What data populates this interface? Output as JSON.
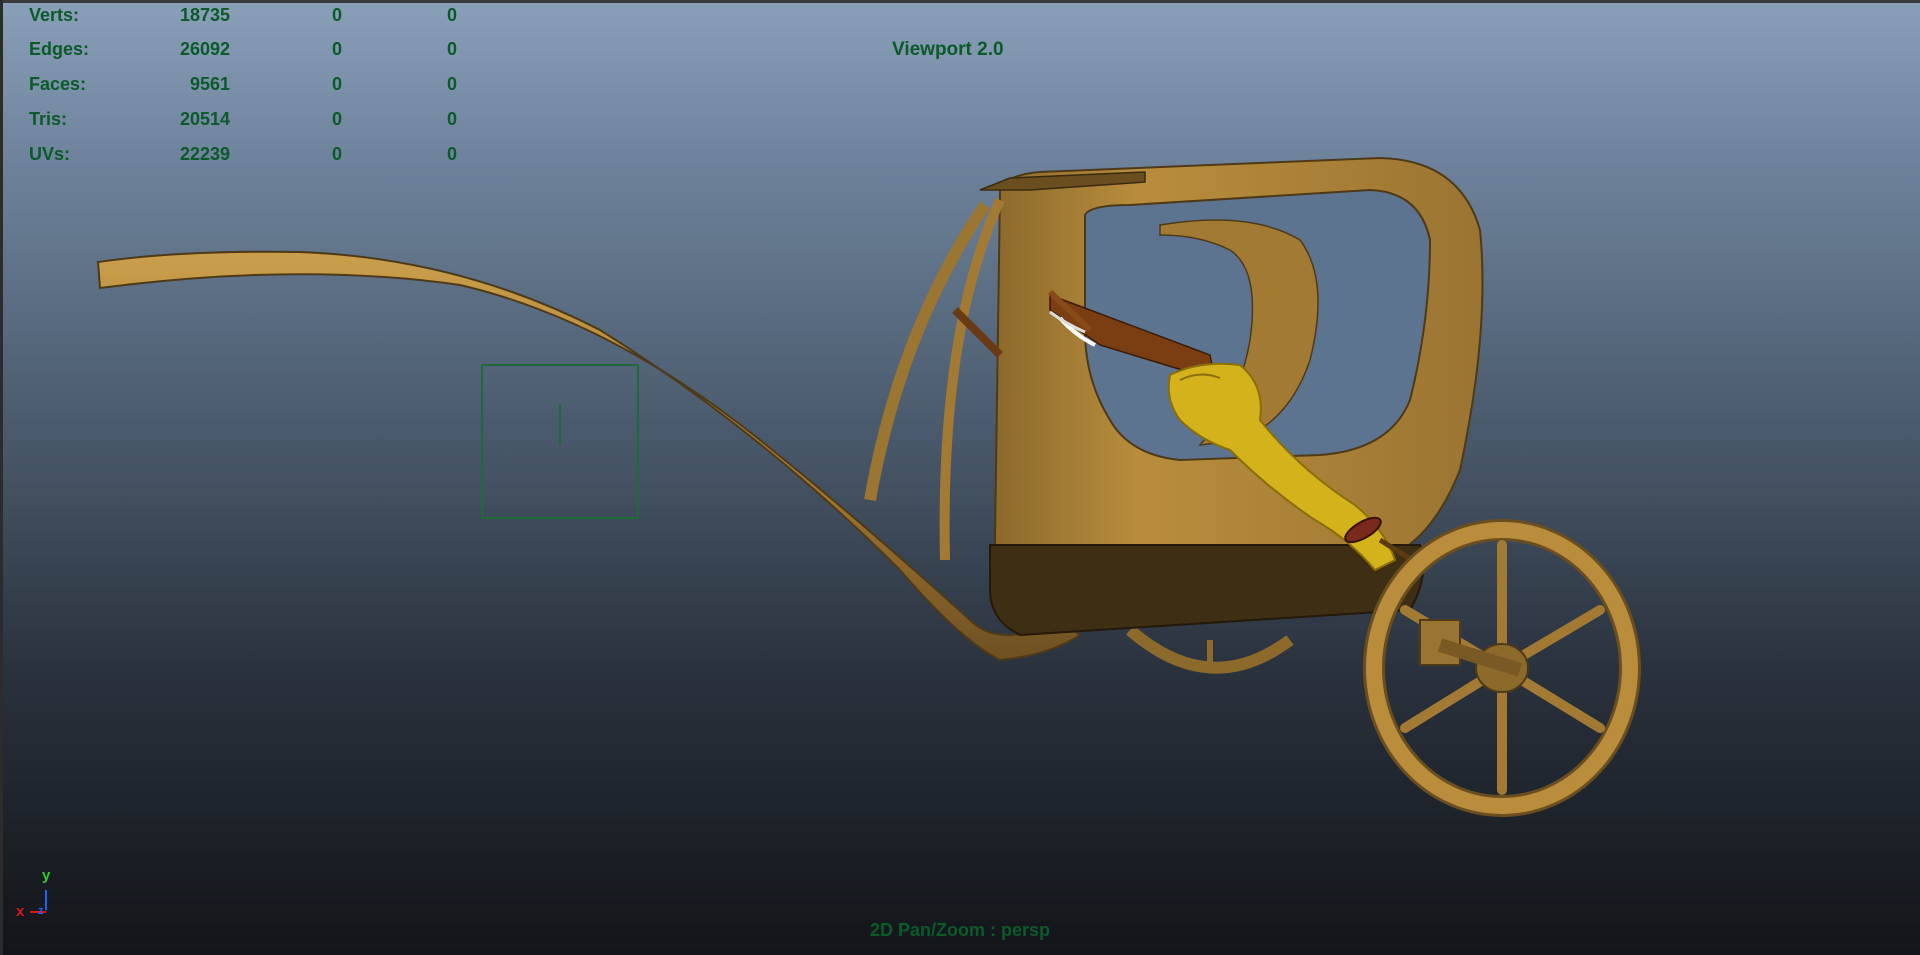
{
  "viewport": {
    "title": "Viewport 2.0",
    "status": "2D Pan/Zoom : persp",
    "background_top": "#8aa0b8",
    "background_bottom": "#121519",
    "hud_color": "#0a5a2a"
  },
  "hud": {
    "rows": [
      {
        "label": "Verts:",
        "v1": "18735",
        "v2": "0",
        "v3": "0"
      },
      {
        "label": "Edges:",
        "v1": "26092",
        "v2": "0",
        "v3": "0"
      },
      {
        "label": "Faces:",
        "v1": "9561",
        "v2": "0",
        "v3": "0"
      },
      {
        "label": "Tris:",
        "v1": "20514",
        "v2": "0",
        "v3": "0"
      },
      {
        "label": "UVs:",
        "v1": "22239",
        "v2": "0",
        "v3": "0"
      }
    ]
  },
  "axis": {
    "x": "x",
    "y": "y",
    "z": "z"
  },
  "scene": {
    "model": "chariot",
    "material_color": "#b98d3c",
    "figure_color": "#d4b21c"
  }
}
